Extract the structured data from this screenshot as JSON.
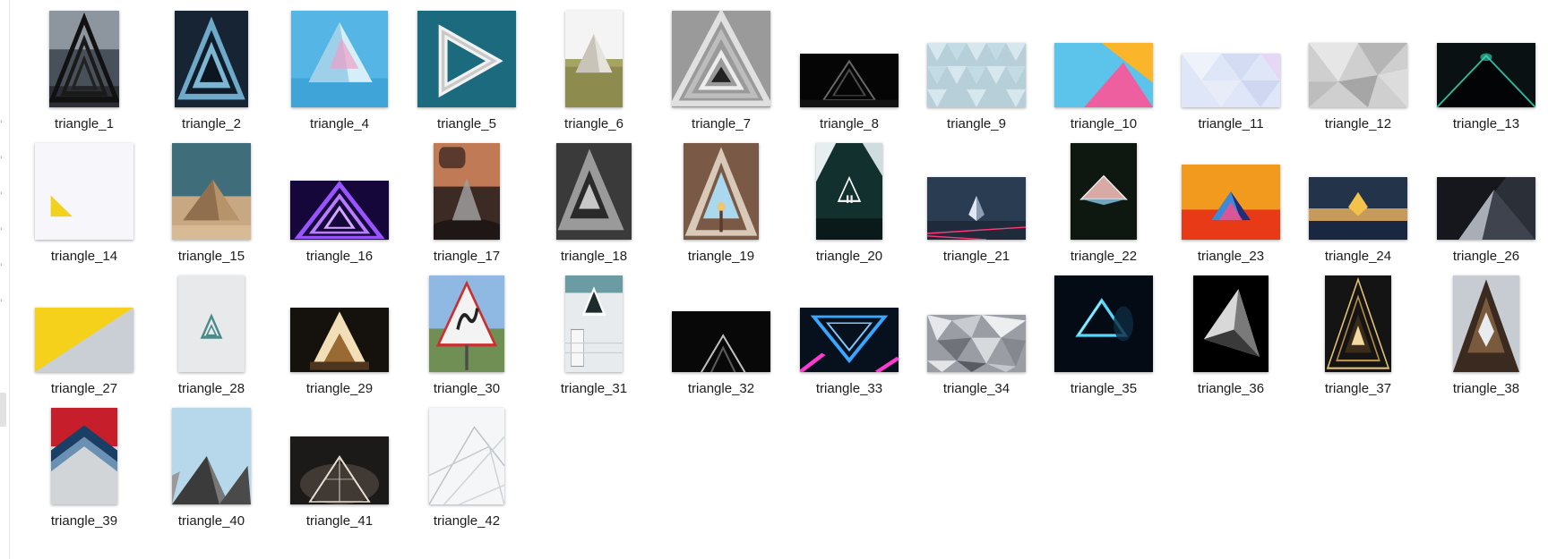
{
  "files": [
    {
      "label": "triangle_1",
      "icon": "triangle-1-thumbnail-icon",
      "orientation": "portrait"
    },
    {
      "label": "triangle_2",
      "icon": "triangle-2-thumbnail-icon",
      "orientation": "portrait"
    },
    {
      "label": "triangle_4",
      "icon": "triangle-4-thumbnail-icon",
      "orientation": "landscape"
    },
    {
      "label": "triangle_5",
      "icon": "triangle-5-thumbnail-icon",
      "orientation": "landscape"
    },
    {
      "label": "triangle_6",
      "icon": "triangle-6-thumbnail-icon",
      "orientation": "portrait"
    },
    {
      "label": "triangle_7",
      "icon": "triangle-7-thumbnail-icon",
      "orientation": "landscape"
    },
    {
      "label": "triangle_8",
      "icon": "triangle-8-thumbnail-icon",
      "orientation": "landscape"
    },
    {
      "label": "triangle_9",
      "icon": "triangle-9-thumbnail-icon",
      "orientation": "landscape"
    },
    {
      "label": "triangle_10",
      "icon": "triangle-10-thumbnail-icon",
      "orientation": "landscape"
    },
    {
      "label": "triangle_11",
      "icon": "triangle-11-thumbnail-icon",
      "orientation": "landscape"
    },
    {
      "label": "triangle_12",
      "icon": "triangle-12-thumbnail-icon",
      "orientation": "landscape"
    },
    {
      "label": "triangle_13",
      "icon": "triangle-13-thumbnail-icon",
      "orientation": "landscape"
    },
    {
      "label": "triangle_14",
      "icon": "triangle-14-thumbnail-icon",
      "orientation": "square"
    },
    {
      "label": "triangle_15",
      "icon": "triangle-15-thumbnail-icon",
      "orientation": "portrait"
    },
    {
      "label": "triangle_16",
      "icon": "triangle-16-thumbnail-icon",
      "orientation": "landscape"
    },
    {
      "label": "triangle_17",
      "icon": "triangle-17-thumbnail-icon",
      "orientation": "portrait"
    },
    {
      "label": "triangle_18",
      "icon": "triangle-18-thumbnail-icon",
      "orientation": "portrait"
    },
    {
      "label": "triangle_19",
      "icon": "triangle-19-thumbnail-icon",
      "orientation": "portrait"
    },
    {
      "label": "triangle_20",
      "icon": "triangle-20-thumbnail-icon",
      "orientation": "portrait"
    },
    {
      "label": "triangle_21",
      "icon": "triangle-21-thumbnail-icon",
      "orientation": "landscape"
    },
    {
      "label": "triangle_22",
      "icon": "triangle-22-thumbnail-icon",
      "orientation": "portrait"
    },
    {
      "label": "triangle_23",
      "icon": "triangle-23-thumbnail-icon",
      "orientation": "landscape"
    },
    {
      "label": "triangle_24",
      "icon": "triangle-24-thumbnail-icon",
      "orientation": "landscape"
    },
    {
      "label": "triangle_26",
      "icon": "triangle-26-thumbnail-icon",
      "orientation": "landscape"
    },
    {
      "label": "triangle_27",
      "icon": "triangle-27-thumbnail-icon",
      "orientation": "landscape"
    },
    {
      "label": "triangle_28",
      "icon": "triangle-28-thumbnail-icon",
      "orientation": "portrait"
    },
    {
      "label": "triangle_29",
      "icon": "triangle-29-thumbnail-icon",
      "orientation": "landscape"
    },
    {
      "label": "triangle_30",
      "icon": "triangle-30-thumbnail-icon",
      "orientation": "portrait"
    },
    {
      "label": "triangle_31",
      "icon": "triangle-31-thumbnail-icon",
      "orientation": "portrait"
    },
    {
      "label": "triangle_32",
      "icon": "triangle-32-thumbnail-icon",
      "orientation": "landscape"
    },
    {
      "label": "triangle_33",
      "icon": "triangle-33-thumbnail-icon",
      "orientation": "landscape"
    },
    {
      "label": "triangle_34",
      "icon": "triangle-34-thumbnail-icon",
      "orientation": "landscape"
    },
    {
      "label": "triangle_35",
      "icon": "triangle-35-thumbnail-icon",
      "orientation": "square"
    },
    {
      "label": "triangle_36",
      "icon": "triangle-36-thumbnail-icon",
      "orientation": "portrait"
    },
    {
      "label": "triangle_37",
      "icon": "triangle-37-thumbnail-icon",
      "orientation": "portrait"
    },
    {
      "label": "triangle_38",
      "icon": "triangle-38-thumbnail-icon",
      "orientation": "portrait"
    },
    {
      "label": "triangle_39",
      "icon": "triangle-39-thumbnail-icon",
      "orientation": "portrait"
    },
    {
      "label": "triangle_40",
      "icon": "triangle-40-thumbnail-icon",
      "orientation": "portrait"
    },
    {
      "label": "triangle_41",
      "icon": "triangle-41-thumbnail-icon",
      "orientation": "landscape"
    },
    {
      "label": "triangle_42",
      "icon": "triangle-42-thumbnail-icon",
      "orientation": "portrait"
    }
  ]
}
